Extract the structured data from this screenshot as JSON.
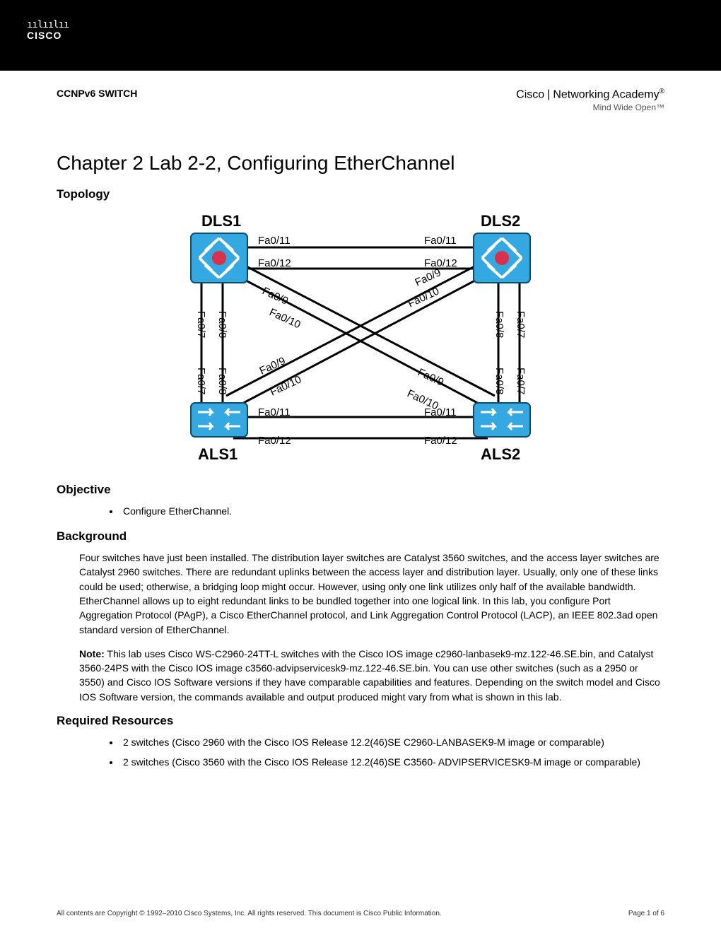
{
  "header": {
    "cisco_logo_bars": "ıılıılıı",
    "cisco_logo_text": "CISCO",
    "doc_tag": "CCNPv6 SWITCH",
    "na_cisco": "Cisco",
    "na_text": "Networking Academy",
    "na_reg": "®",
    "na_tagline": "Mind Wide Open™"
  },
  "title": "Chapter 2 Lab 2-2, Configuring EtherChannel",
  "sections": {
    "topology": "Topology",
    "objective": "Objective",
    "background": "Background",
    "required": "Required Resources"
  },
  "objective_items": [
    "Configure EtherChannel."
  ],
  "background_p1": "Four switches have just been installed. The distribution layer switches are Catalyst 3560 switches, and the access layer switches are Catalyst 2960 switches. There are redundant uplinks between the access layer and distribution layer. Usually, only one of these links could be used; otherwise, a bridging loop might occur. However, using only one link utilizes only half of the available bandwidth. EtherChannel allows up to eight redundant links to be bundled together into one logical link. In this lab, you configure Port Aggregation Protocol (PAgP), a Cisco EtherChannel protocol, and Link Aggregation Control Protocol (LACP), an IEEE 802.3ad open standard version of EtherChannel.",
  "background_note_lead": "Note:",
  "background_note": " This lab uses Cisco WS-C2960-24TT-L switches with the Cisco IOS image c2960-lanbasek9-mz.122-46.SE.bin, and Catalyst 3560-24PS with the Cisco IOS image c3560-advipservicesk9-mz.122-46.SE.bin. You can use other switches (such as a 2950 or 3550) and Cisco IOS Software versions if they have comparable capabilities and features. Depending on the switch model and Cisco IOS Software version, the commands available and output produced might vary from what is shown in this lab.",
  "required_items": [
    "2 switches (Cisco 2960 with the Cisco IOS Release 12.2(46)SE C2960-LANBASEK9-M image or comparable)",
    "2 switches (Cisco 3560 with the Cisco IOS Release 12.2(46)SE C3560- ADVIPSERVICESK9-M image or comparable)"
  ],
  "footer": {
    "copyright": "All contents are Copyright © 1992–2010 Cisco Systems, Inc. All rights reserved. This document is Cisco Public Information.",
    "page": "Page 1 of 6"
  },
  "topology": {
    "devices": {
      "tl": "DLS1",
      "tr": "DLS2",
      "bl": "ALS1",
      "br": "ALS2"
    },
    "ports": {
      "top_left_11": "Fa0/11",
      "top_right_11": "Fa0/11",
      "top_left_12": "Fa0/12",
      "top_right_12": "Fa0/12",
      "diag_tl_9": "Fa0/9",
      "diag_tl_10": "Fa0/10",
      "diag_tr_9": "Fa0/9",
      "diag_tr_10": "Fa0/10",
      "diag_bl_9": "Fa0/9",
      "diag_bl_10": "Fa0/10",
      "diag_br_9": "Fa0/9",
      "diag_br_10": "Fa0/10",
      "left_t_7": "Fa0/7",
      "left_t_8": "Fa0/8",
      "left_b_7": "Fa0/7",
      "left_b_8": "Fa0/8",
      "right_t_7": "Fa0/7",
      "right_t_8": "Fa0/8",
      "right_b_7": "Fa0/7",
      "right_b_8": "Fa0/8",
      "bot_left_11": "Fa0/11",
      "bot_right_11": "Fa0/11",
      "bot_left_12": "Fa0/12",
      "bot_right_12": "Fa0/12"
    }
  }
}
